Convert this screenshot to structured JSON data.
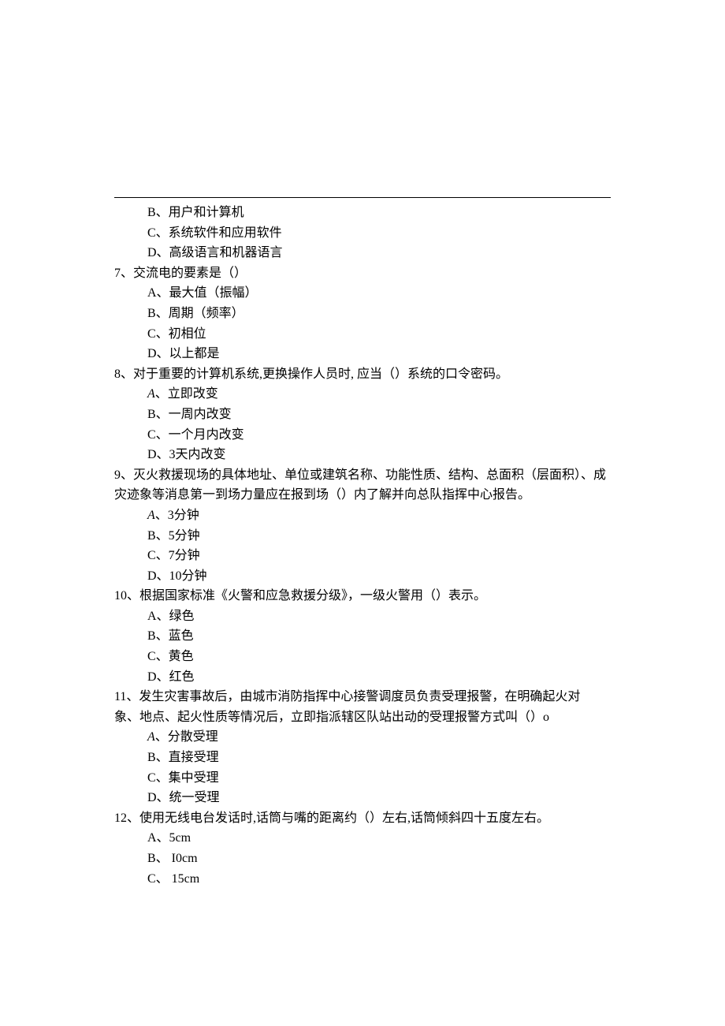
{
  "lines": {
    "q6b": "B、用户和计算机",
    "q6c": "C、系统软件和应用软件",
    "q6d": "D、高级语言和机器语言",
    "q7": "7、交流电的要素是（）",
    "q7a": "A、最大值（振幅）",
    "q7b": "B、周期（频率）",
    "q7c": "C、初相位",
    "q7d": "D、以上都是",
    "q8": "8、对于重要的计算机系统,更换操作人员时, 应当（）系统的口令密码。",
    "q8a_prefix": "A",
    "q8a_suffix": "、立即改变",
    "q8b": "B、一周内改变",
    "q8c": "C、一个月内改变",
    "q8d": "D、3天内改变",
    "q9_l1": "9、灭火救援现场的具体地址、单位或建筑名称、功能性质、结构、总面积（层面积）、成",
    "q9_l2": "灾迹象等消息第一到场力量应在报到场（）内了解并向总队指挥中心报告。",
    "q9a_prefix": "A",
    "q9a_suffix": "、3分钟",
    "q9b": "B、5分钟",
    "q9c": "C、7分钟",
    "q9d": "D、10分钟",
    "q10": "10、根据国家标准《火警和应急救援分级》，一级火警用（）表示。",
    "q10a": "A、绿色",
    "q10b": "B、蓝色",
    "q10c": "C、黄色",
    "q10d": "D、红色",
    "q11_l1": "11、发生灾害事故后，由城市消防指挥中心接警调度员负责受理报警，在明确起火对",
    "q11_l2": "象、地点、起火性质等情况后，立即指派辖区队站出动的受理报警方式叫（）o",
    "q11a_prefix": "A",
    "q11a_suffix": "、分散受理",
    "q11b": "B、直接受理",
    "q11c": "C、集中受理",
    "q11d": "D、统一受理",
    "q12": "12、使用无线电台发话时,话筒与嘴的距离约（）左右,话筒倾斜四十五度左右。",
    "q12a": "A、5cm",
    "q12b": "B、 I0cm",
    "q12c": "C、 15cm"
  }
}
